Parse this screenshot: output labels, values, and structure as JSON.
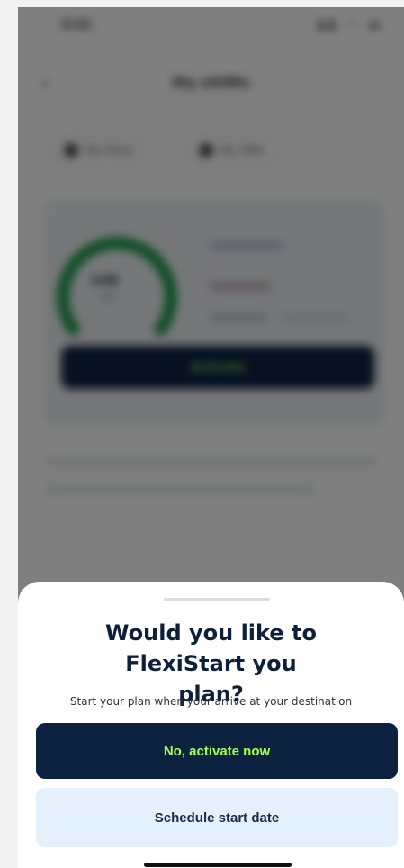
{
  "background_app": {
    "status_time": "9:41",
    "status_icons": "▮▮ ◠ ▬",
    "back_icon": "chevron-left-icon",
    "title": "My eSIMs",
    "pills": [
      {
        "label": "My Plans"
      },
      {
        "label": "My SIMs"
      }
    ],
    "gauge": {
      "value": "1GB",
      "sub": "left",
      "color": "#1e9e4a"
    },
    "activate_label": "Activate"
  },
  "sheet": {
    "title": "Would you like to FlexiStart you plan?",
    "subtitle": "Start your plan when your arrive at your destination",
    "primary_button": "No, activate now",
    "secondary_button": "Schedule start date"
  },
  "colors": {
    "navy": "#0d2240",
    "lime": "#a4ff4d",
    "light_blue": "#e4f0fb"
  }
}
